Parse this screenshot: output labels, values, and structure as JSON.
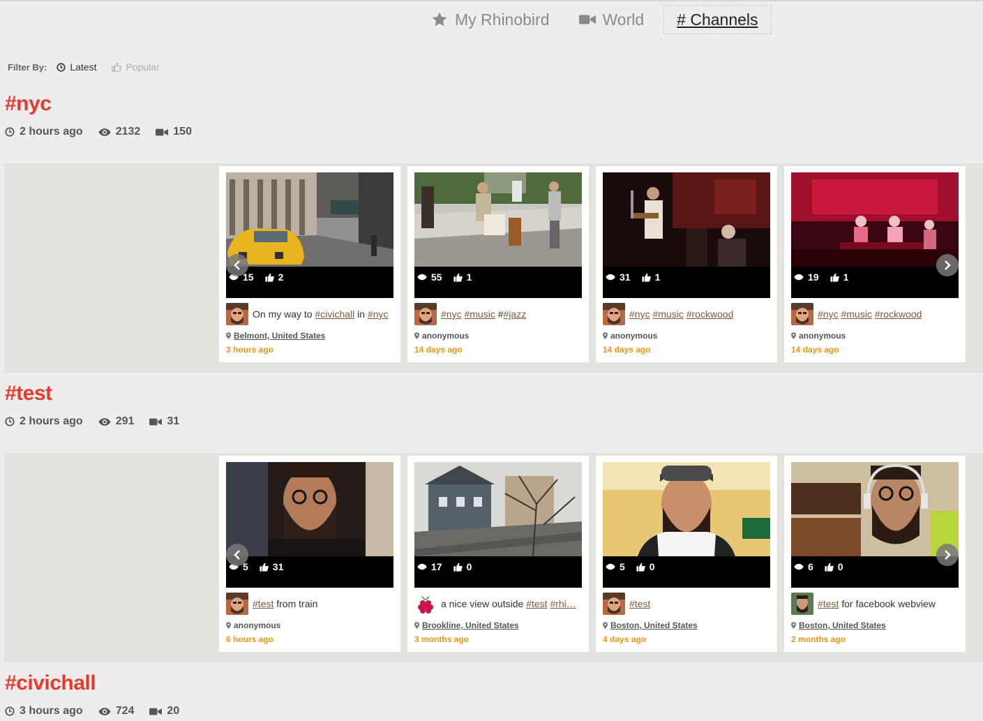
{
  "nav": {
    "items": [
      {
        "label": "My Rhinobird",
        "icon": "star-icon"
      },
      {
        "label": "World",
        "icon": "video-camera-icon"
      },
      {
        "label": "# Channels",
        "icon": "hash-icon"
      }
    ]
  },
  "filter": {
    "label": "Filter By:",
    "options": [
      {
        "label": "Latest",
        "icon": "clock-icon",
        "selected": true
      },
      {
        "label": "Popular",
        "icon": "thumbs-up-icon",
        "selected": false
      }
    ]
  },
  "colors": {
    "accent": "#e83a2f",
    "time": "#f39415",
    "tag": "#7a5a3c"
  },
  "channels": [
    {
      "title": "#nyc",
      "updated": "2 hours ago",
      "views": "2132",
      "videos": "150",
      "cards": [
        {
          "views": "15",
          "likes": "2",
          "caption_pre": "On my way to ",
          "tag1": "#civichall",
          "caption_mid": " in ",
          "tag2": "#nyc",
          "caption_post": "",
          "location": "Belmont, United States",
          "location_is_link": true,
          "time": "3 hours ago"
        },
        {
          "views": "55",
          "likes": "1",
          "caption_pre": "",
          "tag1": "#nyc",
          "caption_mid": " ",
          "tag2": "#music",
          "caption_post": " #",
          "tag3": "#jazz",
          "location": "anonymous",
          "location_is_link": false,
          "time": "14 days ago"
        },
        {
          "views": "31",
          "likes": "1",
          "caption_pre": "",
          "tag1": "#nyc",
          "caption_mid": " ",
          "tag2": "#music",
          "caption_post": " ",
          "tag3": "#rockwood",
          "location": "anonymous",
          "location_is_link": false,
          "time": "14 days ago"
        },
        {
          "views": "19",
          "likes": "1",
          "caption_pre": "",
          "tag1": "#nyc",
          "caption_mid": " ",
          "tag2": "#music",
          "caption_post": " ",
          "tag3": "#rockwood",
          "location": "anonymous",
          "location_is_link": false,
          "time": "14 days ago"
        }
      ]
    },
    {
      "title": "#test",
      "updated": "2 hours ago",
      "views": "291",
      "videos": "31",
      "cards": [
        {
          "views": "5",
          "likes": "31",
          "caption_pre": "",
          "tag1": "#test",
          "caption_mid": " from train",
          "location": "anonymous",
          "location_is_link": false,
          "time": "6 hours ago"
        },
        {
          "views": "17",
          "likes": "0",
          "caption_pre": "a nice view outside ",
          "tag1": "#test",
          "caption_mid": " ",
          "tag2": "#rhi…",
          "location": "Brookline, United States",
          "location_is_link": true,
          "time": "3 months ago"
        },
        {
          "views": "5",
          "likes": "0",
          "caption_pre": "",
          "tag1": "#test",
          "caption_mid": "",
          "location": "Boston, United States",
          "location_is_link": true,
          "time": "4 days ago"
        },
        {
          "views": "6",
          "likes": "0",
          "caption_pre": "",
          "tag1": "#test",
          "caption_mid": " for facebook webview",
          "location": "Boston, United States",
          "location_is_link": true,
          "time": "2 months ago"
        }
      ]
    },
    {
      "title": "#civichall",
      "updated": "3 hours ago",
      "views": "724",
      "videos": "20"
    }
  ]
}
